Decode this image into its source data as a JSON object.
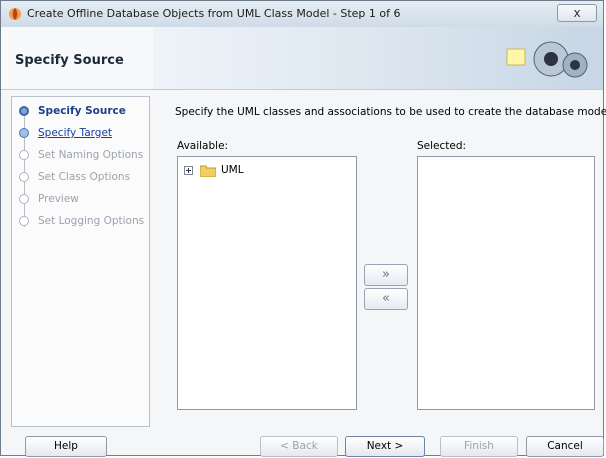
{
  "window": {
    "title": "Create Offline Database Objects from UML Class Model - Step 1 of 6",
    "close_glyph": "x"
  },
  "header": {
    "title": "Specify Source"
  },
  "steps": [
    {
      "label": "Specify Source",
      "state": "current"
    },
    {
      "label": "Specify Target",
      "state": "link"
    },
    {
      "label": "Set Naming Options",
      "state": "disabled"
    },
    {
      "label": "Set Class Options",
      "state": "disabled"
    },
    {
      "label": "Preview",
      "state": "disabled"
    },
    {
      "label": "Set Logging Options",
      "state": "disabled"
    }
  ],
  "main": {
    "instruction": "Specify the UML classes and associations to be used to create the database model.",
    "available_label": "Available:",
    "selected_label": "Selected:",
    "available_items": [
      {
        "label": "UML",
        "icon": "folder-icon"
      }
    ],
    "add_glyph": "»",
    "remove_glyph": "«"
  },
  "footer": {
    "help": "Help",
    "back": "< Back",
    "next": "Next >",
    "finish": "Finish",
    "cancel": "Cancel"
  },
  "colors": {
    "accent": "#1f3e8a",
    "link": "#1b3fa0",
    "disabled_text": "#9aa3ad"
  }
}
